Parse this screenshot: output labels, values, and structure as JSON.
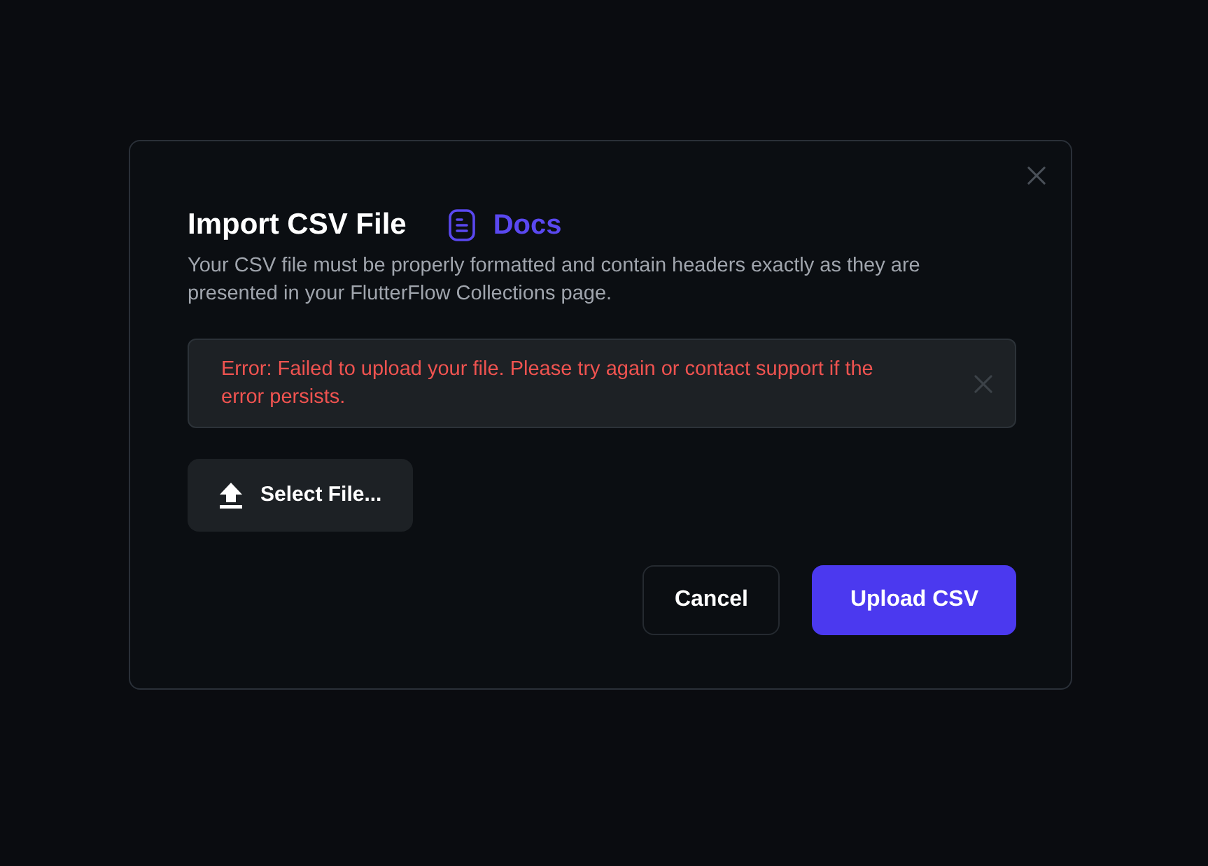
{
  "dialog": {
    "title": "Import CSV File",
    "docs_link": "Docs",
    "description": "Your CSV file must be properly formatted and contain headers exactly as they are presented in your FlutterFlow Collections page.",
    "error": {
      "message": "Error: Failed to upload your file. Please try again or contact support if the error persists."
    },
    "select_button": "Select File...",
    "buttons": [
      {
        "label": "Cancel",
        "kind": "secondary"
      },
      {
        "label": "Upload CSV",
        "kind": "primary"
      }
    ]
  }
}
